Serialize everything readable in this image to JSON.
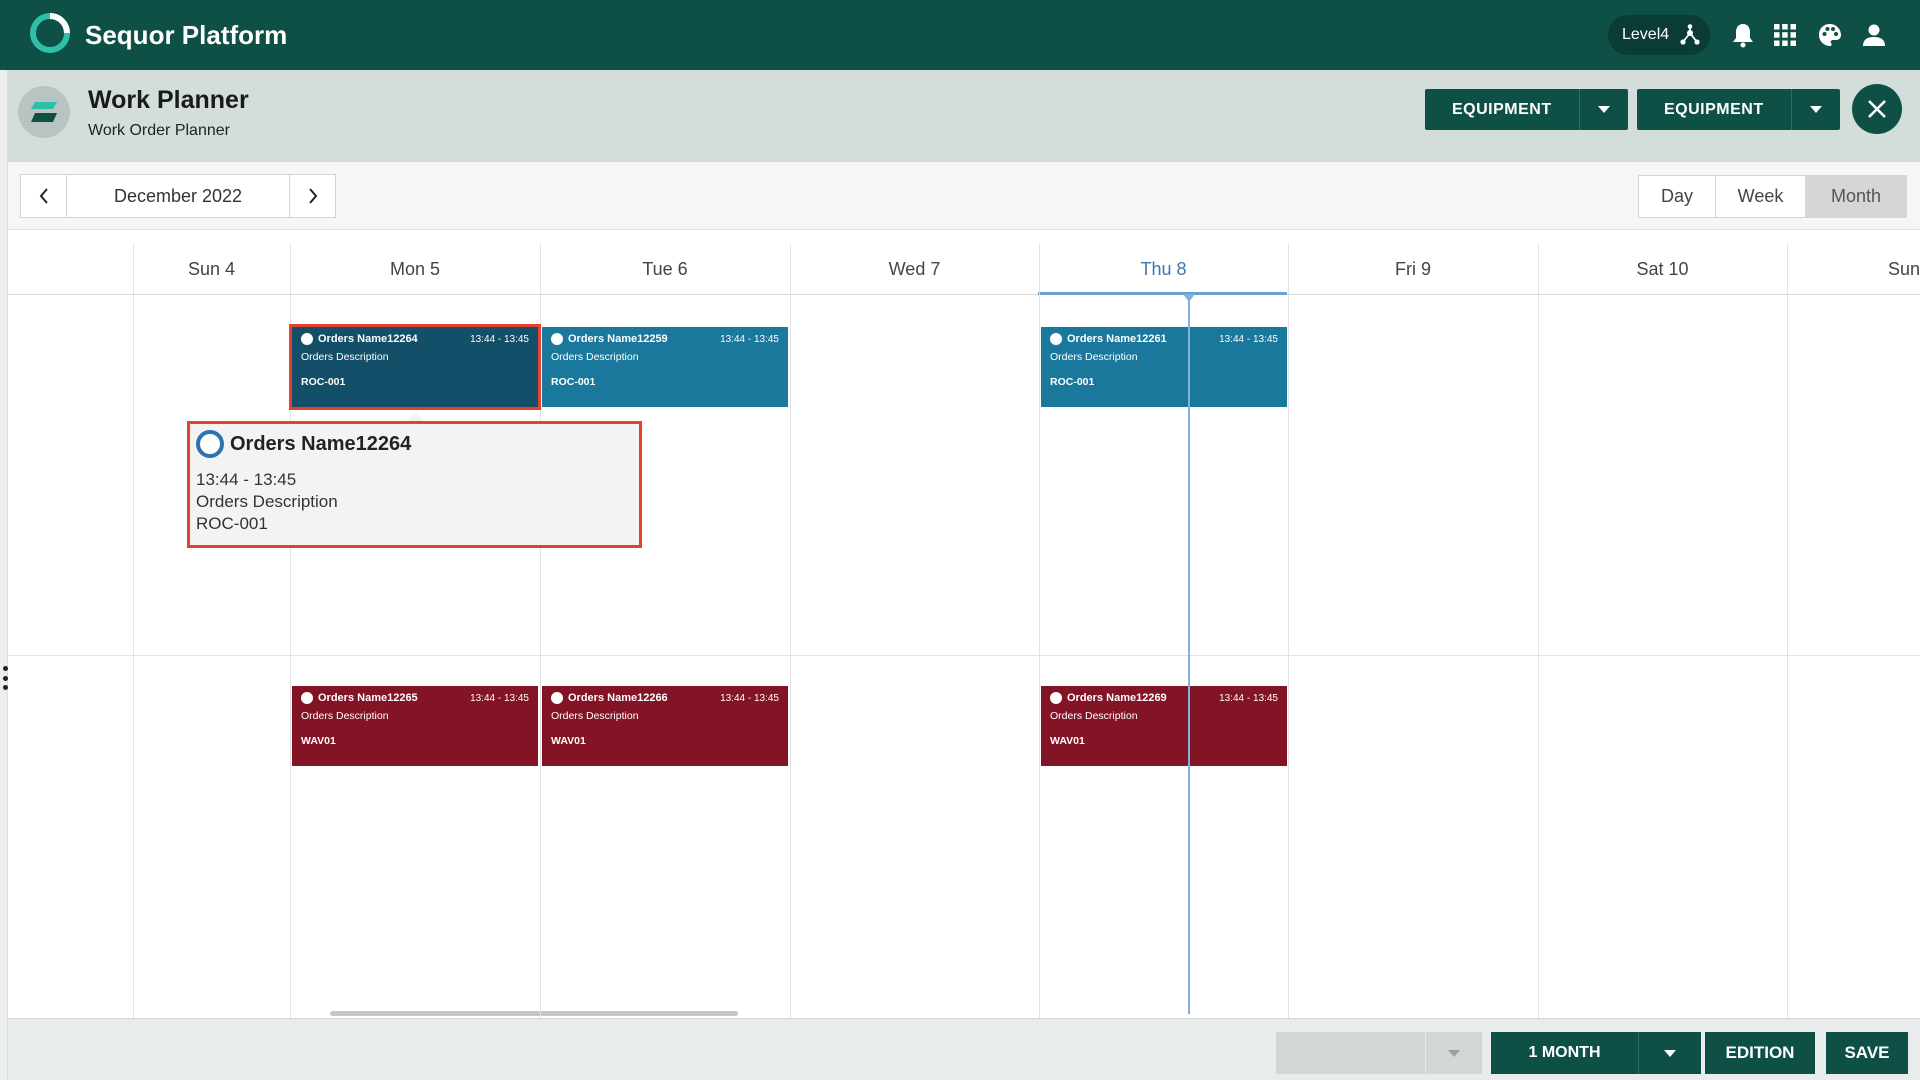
{
  "brand": {
    "title": "Sequor Platform",
    "level_label": "Level4",
    "colors": {
      "primary": "#0f5046",
      "header_bg": "#d3dedb",
      "event_blue": "#1a789c",
      "event_selected": "#134f69",
      "event_red": "#821425",
      "highlight": "#e8402f",
      "today": "#3a78b5"
    }
  },
  "topbar_icons": [
    "hierarchy-icon",
    "bell-icon",
    "apps-grid-icon",
    "palette-icon",
    "user-icon"
  ],
  "header": {
    "title": "Work Planner",
    "subtitle": "Work Order Planner",
    "filter1": "EQUIPMENT",
    "filter2": "EQUIPMENT"
  },
  "toolbar": {
    "date_label": "December 2022",
    "views": [
      "Day",
      "Week",
      "Month"
    ],
    "active_view": "Month"
  },
  "calendar": {
    "days": [
      "Sun 4",
      "Mon 5",
      "Tue 6",
      "Wed 7",
      "Thu 8",
      "Fri 9",
      "Sat 10",
      "Sun"
    ],
    "today": "Thu 8",
    "events": [
      {
        "name": "Orders Name12264",
        "time": "13:44 - 13:45",
        "desc": "Orders Description",
        "code": "ROC-001",
        "day": "Mon 5",
        "row": 0,
        "color": "blue",
        "selected": true
      },
      {
        "name": "Orders Name12259",
        "time": "13:44 - 13:45",
        "desc": "Orders Description",
        "code": "ROC-001",
        "day": "Tue 6",
        "row": 0,
        "color": "blue",
        "selected": false
      },
      {
        "name": "Orders Name12261",
        "time": "13:44 - 13:45",
        "desc": "Orders Description",
        "code": "ROC-001",
        "day": "Thu 8",
        "row": 0,
        "color": "blue",
        "selected": false
      },
      {
        "name": "Orders Name12265",
        "time": "13:44 - 13:45",
        "desc": "Orders Description",
        "code": "WAV01",
        "day": "Mon 5",
        "row": 1,
        "color": "red",
        "selected": false
      },
      {
        "name": "Orders Name12266",
        "time": "13:44 - 13:45",
        "desc": "Orders Description",
        "code": "WAV01",
        "day": "Tue 6",
        "row": 1,
        "color": "red",
        "selected": false
      },
      {
        "name": "Orders Name12269",
        "time": "13:44 - 13:45",
        "desc": "Orders Description",
        "code": "WAV01",
        "day": "Thu 8",
        "row": 1,
        "color": "red",
        "selected": false
      }
    ]
  },
  "tooltip": {
    "name": "Orders Name12264",
    "time": "13:44 - 13:45",
    "desc": "Orders Description",
    "code": "ROC-001"
  },
  "footer": {
    "select_value": "",
    "range_label": "1 MONTH",
    "edition_label": "EDITION",
    "save_label": "SAVE"
  }
}
